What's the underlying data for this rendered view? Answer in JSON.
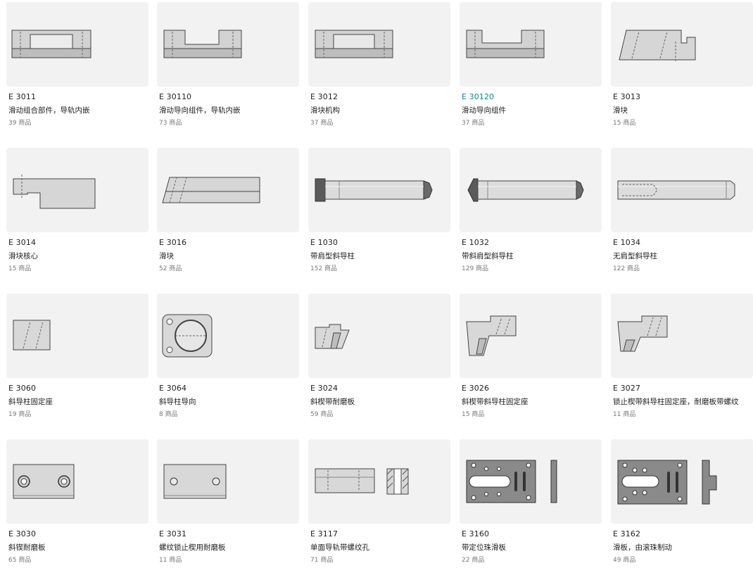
{
  "products": [
    {
      "code": "E 3011",
      "name": "滑动组合部件，导轨内嵌",
      "count": "39 商品",
      "icon": "slide-assembly-rail-inset-icon"
    },
    {
      "code": "E 30110",
      "name": "滑动导向组件，导轨内嵌",
      "count": "73 商品",
      "icon": "slide-guide-rail-inset-icon"
    },
    {
      "code": "E 3012",
      "name": "滑块机构",
      "count": "37 商品",
      "icon": "slide-mechanism-icon"
    },
    {
      "code": "E 30120",
      "name": "滑动导向组件",
      "count": "37 商品",
      "icon": "slide-guide-unit-icon",
      "active": true
    },
    {
      "code": "E 3013",
      "name": "滑块",
      "count": "15 商品",
      "icon": "slide-block-icon"
    },
    {
      "code": "E 3014",
      "name": "滑块核心",
      "count": "15 商品",
      "icon": "slide-core-icon"
    },
    {
      "code": "E 3016",
      "name": "滑块",
      "count": "52 商品",
      "icon": "slide-bar-icon"
    },
    {
      "code": "E 1030",
      "name": "带肩型斜导柱",
      "count": "152 商品",
      "icon": "shoulder-angle-pin-icon"
    },
    {
      "code": "E 1032",
      "name": "带斜肩型斜导柱",
      "count": "129 商品",
      "icon": "bevel-shoulder-angle-pin-icon"
    },
    {
      "code": "E 1034",
      "name": "无肩型斜导柱",
      "count": "122 商品",
      "icon": "straight-angle-pin-icon"
    },
    {
      "code": "E 3060",
      "name": "斜导柱固定座",
      "count": "19 商品",
      "icon": "angle-pin-holder-icon"
    },
    {
      "code": "E 3064",
      "name": "斜导柱导向",
      "count": "8 商品",
      "icon": "angle-pin-guide-icon"
    },
    {
      "code": "E 3024",
      "name": "斜楔带耐磨板",
      "count": "59 商品",
      "icon": "wedge-wear-plate-icon"
    },
    {
      "code": "E 3026",
      "name": "斜楔带斜导柱固定座",
      "count": "15 商品",
      "icon": "wedge-pin-holder-icon"
    },
    {
      "code": "E 3027",
      "name": "锁止楔带斜导柱固定座，耐磨板带螺纹",
      "count": "11 商品",
      "icon": "locking-wedge-icon"
    },
    {
      "code": "E 3030",
      "name": "斜锲耐磨板",
      "count": "65 商品",
      "icon": "wedge-wear-pad-icon"
    },
    {
      "code": "E 3031",
      "name": "螺纹锁止楔用耐磨板",
      "count": "11 商品",
      "icon": "threaded-wear-plate-icon"
    },
    {
      "code": "E 3117",
      "name": "单面导轨带螺纹孔",
      "count": "71 商品",
      "icon": "single-rail-threaded-icon"
    },
    {
      "code": "E 3160",
      "name": "带定位珠滑板",
      "count": "22 商品",
      "icon": "ball-detent-slide-plate-icon"
    },
    {
      "code": "E 3162",
      "name": "滑板，由滚珠制动",
      "count": "49 商品",
      "icon": "ball-brake-slide-plate-icon"
    }
  ]
}
